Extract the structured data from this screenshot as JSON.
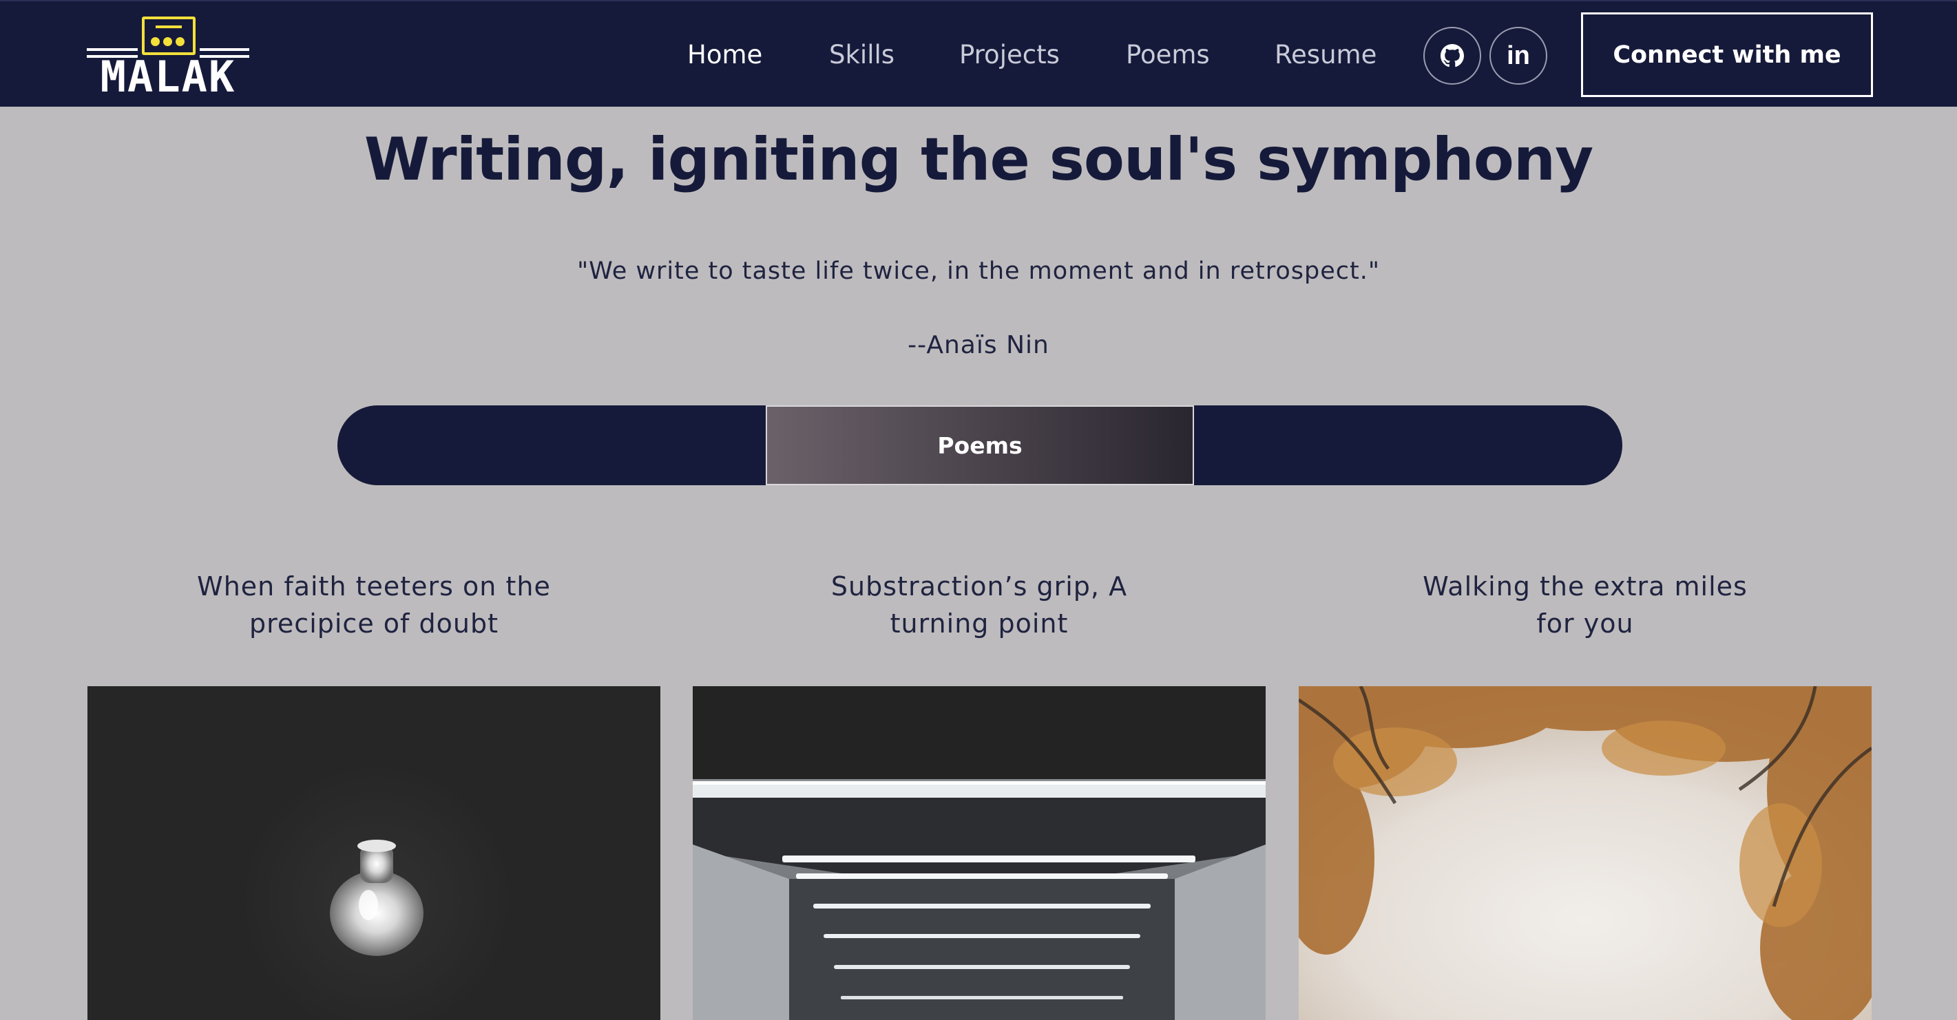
{
  "brand": {
    "logo_text": "MALAK",
    "accent_color": "#f3e03b",
    "nav_background": "#161a3a"
  },
  "nav": {
    "links": [
      {
        "label": "Home",
        "active": true
      },
      {
        "label": "Skills",
        "active": false
      },
      {
        "label": "Projects",
        "active": false
      },
      {
        "label": "Poems",
        "active": false
      },
      {
        "label": "Resume",
        "active": false
      }
    ],
    "social_icons": [
      "github-icon",
      "linkedin-icon"
    ],
    "linkedin_glyph": "in",
    "cta_label": "Connect with me"
  },
  "hero": {
    "title": "Writing, igniting the soul's symphony",
    "quote": "\"We write to taste life twice, in the moment and in retrospect.\"",
    "author": "--Anaïs Nin"
  },
  "tabs": {
    "items": [
      {
        "label": "",
        "active": false
      },
      {
        "label": "Poems",
        "active": true
      },
      {
        "label": "",
        "active": false
      }
    ]
  },
  "poems": [
    {
      "title_line1": "When faith teeters on the",
      "title_line2": "precipice of doubt",
      "image_icon": "light-bulb-image"
    },
    {
      "title_line1": "Substraction’s grip, A",
      "title_line2": "turning point",
      "image_icon": "tunnel-lights-image"
    },
    {
      "title_line1": "Walking the extra miles",
      "title_line2": "for you",
      "image_icon": "autumn-trees-image"
    }
  ]
}
